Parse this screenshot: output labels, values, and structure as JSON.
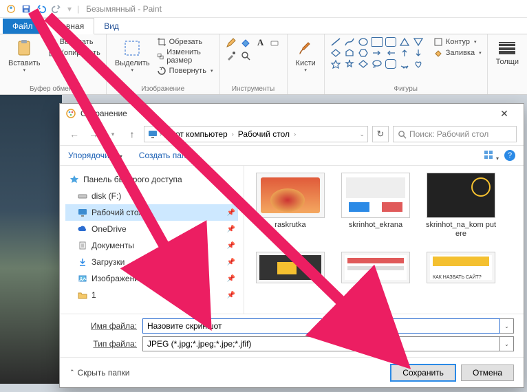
{
  "title_bar": {
    "app_title": "Безымянный - Paint"
  },
  "tabs": {
    "file": "Файл",
    "home": "Главная",
    "view": "Вид"
  },
  "ribbon": {
    "clipboard": {
      "label": "Буфер обмена",
      "paste": "Вставить",
      "cut": "Вырезать",
      "copy": "Копировать"
    },
    "image": {
      "label": "Изображение",
      "select": "Выделить",
      "crop": "Обрезать",
      "resize": "Изменить размер",
      "rotate": "Повернуть"
    },
    "tools": {
      "label": "Инструменты"
    },
    "brushes": {
      "label": "Кисти"
    },
    "shapes": {
      "label": "Фигуры",
      "outline": "Контур",
      "fill": "Заливка"
    },
    "thickness": {
      "label": "Толщи"
    }
  },
  "dialog": {
    "title": "Сохранение",
    "breadcrumb": {
      "root": "Этот компьютер",
      "folder": "Рабочий стол"
    },
    "search_placeholder": "Поиск: Рабочий стол",
    "toolbar": {
      "organize": "Упорядочить",
      "new_folder": "Создать папку"
    },
    "tree": {
      "quick_access": "Панель быстрого доступа",
      "items": [
        {
          "label": "disk (F:)",
          "icon": "drive"
        },
        {
          "label": "Рабочий стол",
          "icon": "desktop",
          "selected": true
        },
        {
          "label": "OneDrive",
          "icon": "onedrive"
        },
        {
          "label": "Документы",
          "icon": "documents"
        },
        {
          "label": "Загрузки",
          "icon": "downloads"
        },
        {
          "label": "Изображения",
          "icon": "pictures"
        },
        {
          "label": "1",
          "icon": "folder"
        }
      ]
    },
    "files": [
      {
        "name": "raskrutka"
      },
      {
        "name": "skrinhot_ekrana"
      },
      {
        "name": "skrinhot_na_kom putere"
      }
    ],
    "filename_label": "Имя файла:",
    "filename_value": "Назовите скриншот",
    "filetype_label": "Тип файла:",
    "filetype_value": "JPEG (*.jpg;*.jpeg;*.jpe;*.jfif)",
    "hide_folders": "Скрыть папки",
    "save": "Сохранить",
    "cancel": "Отмена"
  }
}
